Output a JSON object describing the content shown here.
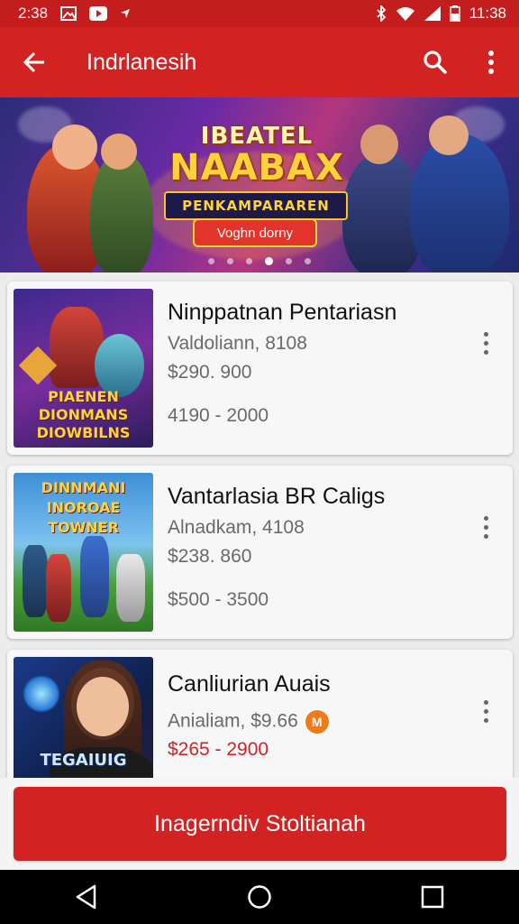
{
  "status_bar": {
    "time_left": "2:38",
    "time_right": "11:38",
    "icons": [
      "image-icon",
      "youtube-icon",
      "location-arrow-icon",
      "bluetooth-icon",
      "wifi-icon",
      "signal-icon",
      "battery-icon"
    ]
  },
  "app_bar": {
    "title": "Indrlanesih",
    "back_icon": "arrow-back-icon",
    "search_icon": "search-icon",
    "more_icon": "more-vertical-icon"
  },
  "banner": {
    "title_top": "IBEATEL",
    "title_main": "NAABAX",
    "subtitle": "PENKAMPARAREN",
    "button_label": "Voghn dorny",
    "slide_count": 6,
    "active_slide": 4
  },
  "games": [
    {
      "name": "Ninppatnan Pentariasn",
      "line1": "Valdoliann, 8108",
      "line2": "$290. 900",
      "line3": "4190 - 2000",
      "thumb_text": "PIAENEN DIONMANS DIOWBILNS"
    },
    {
      "name": "Vantarlasia BR Caligs",
      "line1": "Alnadkam, 4108",
      "line2": "$238. 860",
      "line3": "$500 - 3500",
      "thumb_text": "DINNMANI INOROAE TOWNER"
    },
    {
      "name": "Canliurian Auais",
      "line1": "Anialiam, $9.66",
      "line2": "$265 - 2900",
      "badge": "M",
      "thumb_text": "TEGAIUIG"
    }
  ],
  "cta": {
    "label": "Inagerndiv Stoltianah"
  },
  "nav_bar": {
    "back_icon": "nav-back-icon",
    "home_icon": "nav-home-icon",
    "recents_icon": "nav-recents-icon"
  },
  "colors": {
    "primary": "#d32222",
    "status": "#c41d1d",
    "accent": "#f07a1a"
  }
}
